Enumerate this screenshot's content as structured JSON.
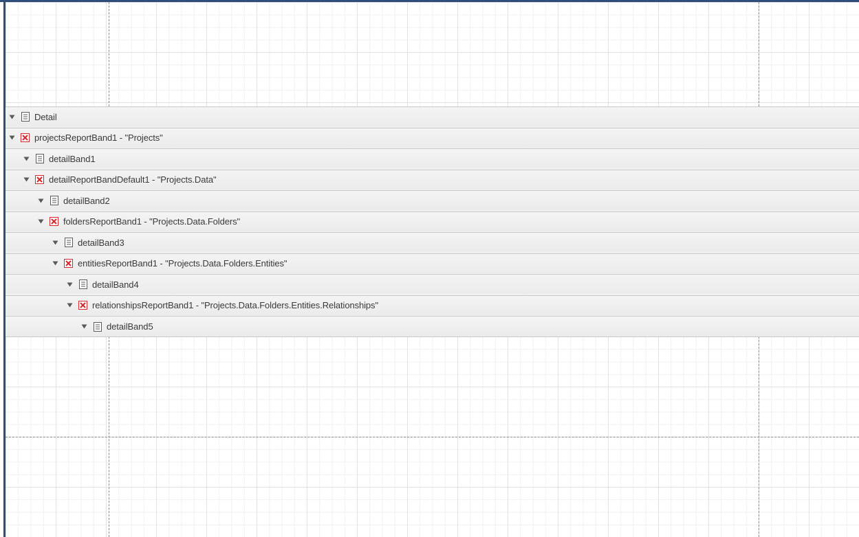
{
  "colors": {
    "frame": "#2f4f7a",
    "band_background": "#eeeeee",
    "band_border": "#c8c8c8",
    "text": "#3a3a3a",
    "detail_report_icon": "#d9262b"
  },
  "bands": [
    {
      "level": 0,
      "icon": "detail-band-icon",
      "label": "Detail"
    },
    {
      "level": 0,
      "icon": "detail-report-band-icon",
      "label": "projectsReportBand1 - \"Projects\""
    },
    {
      "level": 1,
      "icon": "detail-band-icon",
      "label": "detailBand1"
    },
    {
      "level": 1,
      "icon": "detail-report-band-icon",
      "label": "detailReportBandDefault1 - \"Projects.Data\""
    },
    {
      "level": 2,
      "icon": "detail-band-icon",
      "label": "detailBand2"
    },
    {
      "level": 2,
      "icon": "detail-report-band-icon",
      "label": "foldersReportBand1 - \"Projects.Data.Folders\""
    },
    {
      "level": 3,
      "icon": "detail-band-icon",
      "label": "detailBand3"
    },
    {
      "level": 3,
      "icon": "detail-report-band-icon",
      "label": "entitiesReportBand1 - \"Projects.Data.Folders.Entities\""
    },
    {
      "level": 4,
      "icon": "detail-band-icon",
      "label": "detailBand4"
    },
    {
      "level": 4,
      "icon": "detail-report-band-icon",
      "label": "relationshipsReportBand1 - \"Projects.Data.Folders.Entities.Relationships\""
    },
    {
      "level": 5,
      "icon": "detail-band-icon",
      "label": "detailBand5"
    }
  ]
}
